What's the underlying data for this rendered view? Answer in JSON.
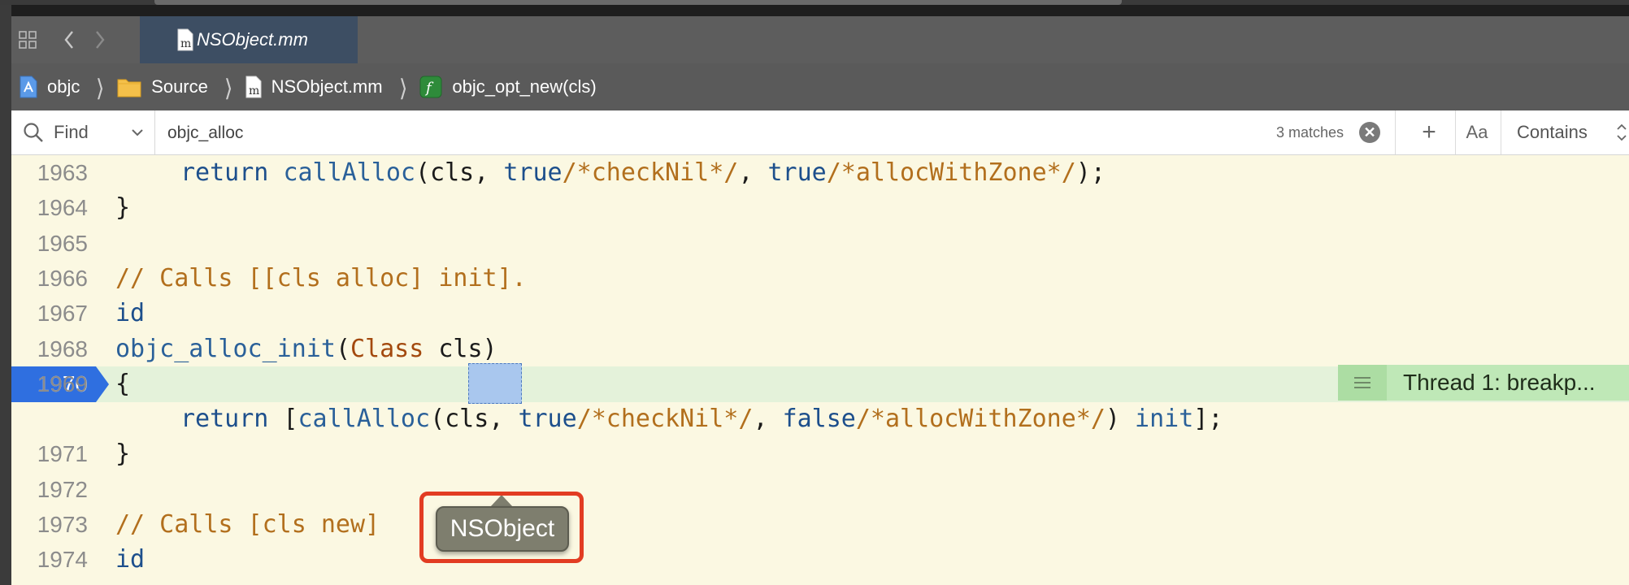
{
  "tab": {
    "filename": "NSObject.mm"
  },
  "breadcrumb": [
    {
      "label": "objc",
      "icon": "project-icon"
    },
    {
      "label": "Source",
      "icon": "folder-icon"
    },
    {
      "label": "NSObject.mm",
      "icon": "objc-file-icon"
    },
    {
      "label": "objc_opt_new(cls)",
      "icon": "function-icon"
    }
  ],
  "find": {
    "mode": "Find",
    "query": "objc_alloc",
    "match_count": "3 matches",
    "case_label": "Aa",
    "match_style": "Contains"
  },
  "code": {
    "line_numbers": [
      "1963",
      "1964",
      "1965",
      "1966",
      "1967",
      "1968",
      "1969",
      "1970",
      "1971",
      "1972",
      "1973",
      "1974"
    ],
    "l1963": {
      "kw_return": "return",
      "fn_callAlloc": "callAlloc",
      "p1": "(cls, ",
      "kw_true1": "true",
      "c1": "/*checkNil*/",
      "p2": ", ",
      "kw_true2": "true",
      "c2": "/*allocWithZone*/",
      "p3": ");"
    },
    "l1964": "}",
    "l1966": "// Calls [[cls alloc] init].",
    "l1967": "id",
    "l1968": {
      "fn": "objc_alloc_init",
      "p1": "(",
      "ty": "Class",
      "p2": " cls)"
    },
    "l1969": "{",
    "l1970": {
      "kw_return": "return",
      "p0": " [",
      "fn_callAlloc": "callAlloc",
      "p1": "(",
      "cls": "cls",
      "p2": ", ",
      "kw_true": "true",
      "c1": "/*checkNil*/",
      "p3": ", ",
      "kw_false": "false",
      "c2": "/*allocWithZone*/",
      "p4": ") ",
      "fn_init": "init",
      "p5": "];"
    },
    "l1971": "}",
    "l1973": "// Calls [cls new]",
    "l1974": "id"
  },
  "breakpoint_line": "1970",
  "thread_indicator": "Thread 1: breakp...",
  "popover": {
    "value": "NSObject"
  },
  "colors": {
    "keyword": "#1d4f8c",
    "comment": "#b26f1d",
    "type": "#a3490e",
    "breakpoint": "#2f6fe0",
    "editor_background": "#fbf8e2",
    "highlight_outline": "#e23c22"
  }
}
